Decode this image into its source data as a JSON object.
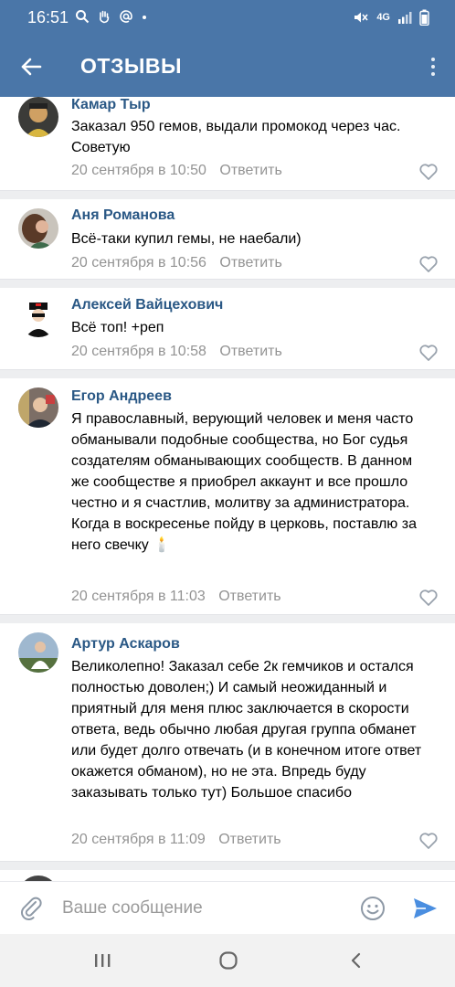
{
  "status_bar": {
    "time": "16:51",
    "left_icons": [
      "search-icon",
      "hand-icon",
      "at-icon",
      "dot-icon"
    ],
    "right_icons": [
      "mute-icon",
      "lte-signal-icon",
      "signal-icon",
      "battery-icon"
    ],
    "network_label": "4G"
  },
  "header": {
    "title": "ОТЗЫВЫ",
    "back_icon": "arrow-left-icon",
    "menu_icon": "more-vertical-icon"
  },
  "comments": [
    {
      "name": "Камар Тыр",
      "text": "Заказал 950 гемов, выдали промокод через час. Советую",
      "date": "20 сентября в 10:50",
      "reply": "Ответить"
    },
    {
      "name": "Аня Романова",
      "text": "Всё-таки купил гемы, не наебали)",
      "date": "20 сентября в 10:56",
      "reply": "Ответить"
    },
    {
      "name": "Алексей Вайцехович",
      "text": "Всё топ! +реп",
      "date": "20 сентября в 10:58",
      "reply": "Ответить"
    },
    {
      "name": "Егор Андреев",
      "text": "Я православный, верующий человек и меня часто обманывали подобные сообщества, но Бог судья создателям обманывающих сообществ. В данном же сообществе я приобрел аккаунт и все прошло честно и я счастлив, молитву за администратора. Когда в воскресенье пойду в церковь, поставлю за него свечку 🕯️",
      "date": "20 сентября в 11:03",
      "reply": "Ответить"
    },
    {
      "name": "Артур Аскаров",
      "text": "Великолепно! Заказал себе 2к гемчиков и остался полностью доволен;) И самый неожиданный и приятный для меня плюс заключается в скорости ответа, ведь обычно любая другая группа обманет или будет долго отвечать (и в конечном итоге ответ окажется обманом), но не эта. Впредь буду заказывать только тут) Большое спасибо",
      "date": "20 сентября в 11:09",
      "reply": "Ответить"
    }
  ],
  "composer": {
    "placeholder": "Ваше сообщение",
    "attach_icon": "paperclip-icon",
    "emoji_icon": "smiley-icon",
    "send_icon": "send-icon"
  },
  "nav_bar": {
    "icons": [
      "recent-apps-icon",
      "home-icon",
      "back-icon"
    ]
  },
  "colors": {
    "header": "#4a76a8",
    "name": "#2a5885",
    "meta": "#939393",
    "send": "#4a8ee0",
    "divider": "#edeef0"
  }
}
